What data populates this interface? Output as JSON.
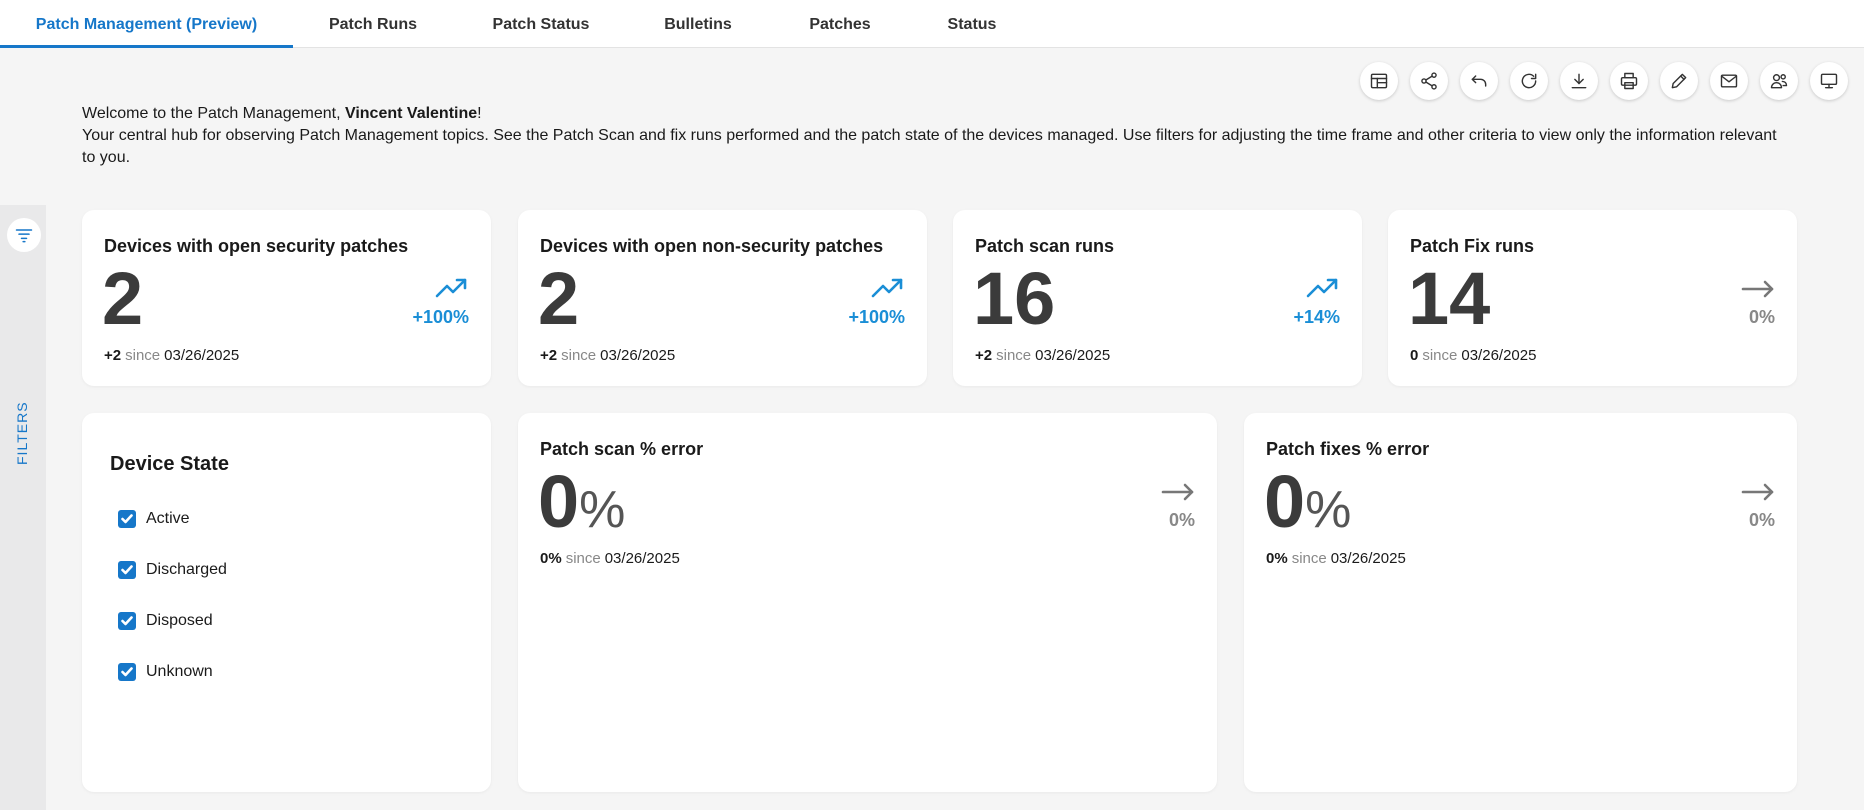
{
  "tabs": [
    {
      "label": "Patch Management (Preview)"
    },
    {
      "label": "Patch Runs"
    },
    {
      "label": "Patch Status"
    },
    {
      "label": "Bulletins"
    },
    {
      "label": "Patches"
    },
    {
      "label": "Status"
    }
  ],
  "toolbar": [
    "table-layout-icon",
    "share-icon",
    "undo-icon",
    "refresh-icon",
    "download-icon",
    "print-icon",
    "edit-icon",
    "mail-icon",
    "users-icon",
    "monitor-icon"
  ],
  "welcome": {
    "greeting_prefix": "Welcome to the Patch Management, ",
    "user_name": "Vincent Valentine",
    "greeting_suffix": "!",
    "description": "Your central hub for observing Patch Management topics. See the Patch Scan and fix runs performed and the patch state of the devices managed. Use filters for adjusting the time frame and other criteria to view only the information relevant to you."
  },
  "filters": {
    "label": "FILTERS"
  },
  "kpis": [
    {
      "title": "Devices with open security patches",
      "value": "2",
      "change": "+100%",
      "delta": "+2",
      "since_label": "since",
      "date": "03/26/2025",
      "trend": "up"
    },
    {
      "title": "Devices with open non-security patches",
      "value": "2",
      "change": "+100%",
      "delta": "+2",
      "since_label": "since",
      "date": "03/26/2025",
      "trend": "up"
    },
    {
      "title": "Patch scan runs",
      "value": "16",
      "change": "+14%",
      "delta": "+2",
      "since_label": "since",
      "date": "03/26/2025",
      "trend": "up"
    },
    {
      "title": "Patch Fix runs",
      "value": "14",
      "change": "0%",
      "delta": "0",
      "since_label": "since",
      "date": "03/26/2025",
      "trend": "flat"
    }
  ],
  "device_state": {
    "title": "Device State",
    "options": [
      {
        "label": "Active",
        "checked": true
      },
      {
        "label": "Discharged",
        "checked": true
      },
      {
        "label": "Disposed",
        "checked": true
      },
      {
        "label": "Unknown",
        "checked": true
      }
    ]
  },
  "error_cards": [
    {
      "title": "Patch scan % error",
      "value": "0",
      "unit": "%",
      "change": "0%",
      "delta": "0%",
      "since_label": "since",
      "date": "03/26/2025",
      "trend": "flat"
    },
    {
      "title": "Patch fixes % error",
      "value": "0",
      "unit": "%",
      "change": "0%",
      "delta": "0%",
      "since_label": "since",
      "date": "03/26/2025",
      "trend": "flat"
    }
  ],
  "colors": {
    "accent": "#1677c9",
    "trend_up": "#1a8ed6",
    "background": "#f5f5f5"
  }
}
